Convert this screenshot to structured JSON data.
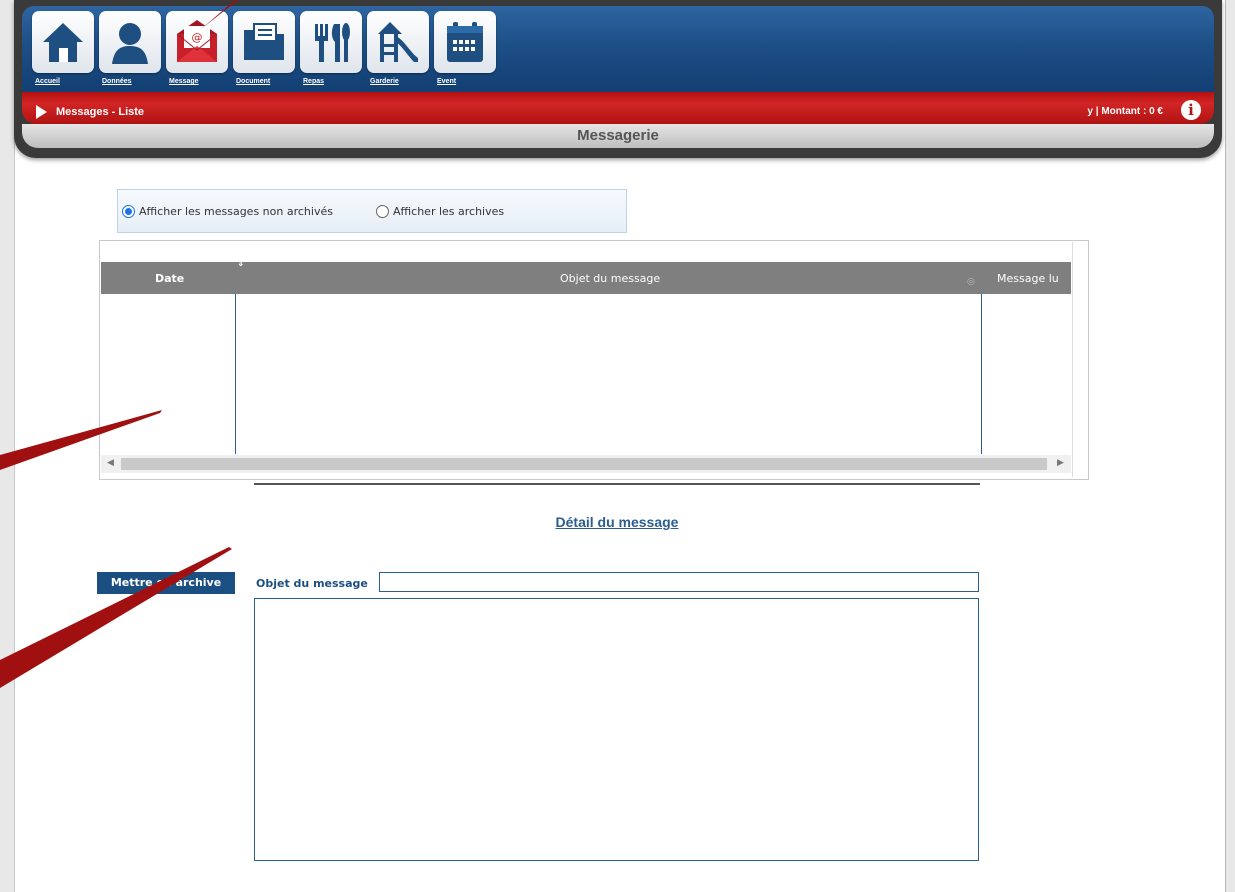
{
  "nav": {
    "items": [
      {
        "label": "Accueil",
        "icon": "home-icon"
      },
      {
        "label": "Données",
        "icon": "user-icon"
      },
      {
        "label": "Message",
        "icon": "envelope-icon"
      },
      {
        "label": "Document",
        "icon": "folder-icon"
      },
      {
        "label": "Repas",
        "icon": "cutlery-icon"
      },
      {
        "label": "Garderie",
        "icon": "playground-icon"
      },
      {
        "label": "Event",
        "icon": "calendar-icon"
      }
    ]
  },
  "breadcrumb": "Messages - Liste",
  "amount": "y | Montant : 0 €",
  "app_title": "Messagerie",
  "filter": {
    "option_active": "Afficher les messages non archivés",
    "option_archives": "Afficher les archives",
    "selected": "Afficher les messages non archivés"
  },
  "table": {
    "columns": [
      "Date",
      "Objet du message",
      "Message lu"
    ],
    "rows": []
  },
  "detail": {
    "title": "Détail du message",
    "archive_button": "Mettre en archive",
    "subject_label": "Objet du message",
    "subject_value": "",
    "body_value": ""
  },
  "colors": {
    "header_blue": "#1d4f87",
    "header_red": "#c21a1a",
    "accent": "#1b4f82",
    "annotation_arrow": "#a01010"
  }
}
